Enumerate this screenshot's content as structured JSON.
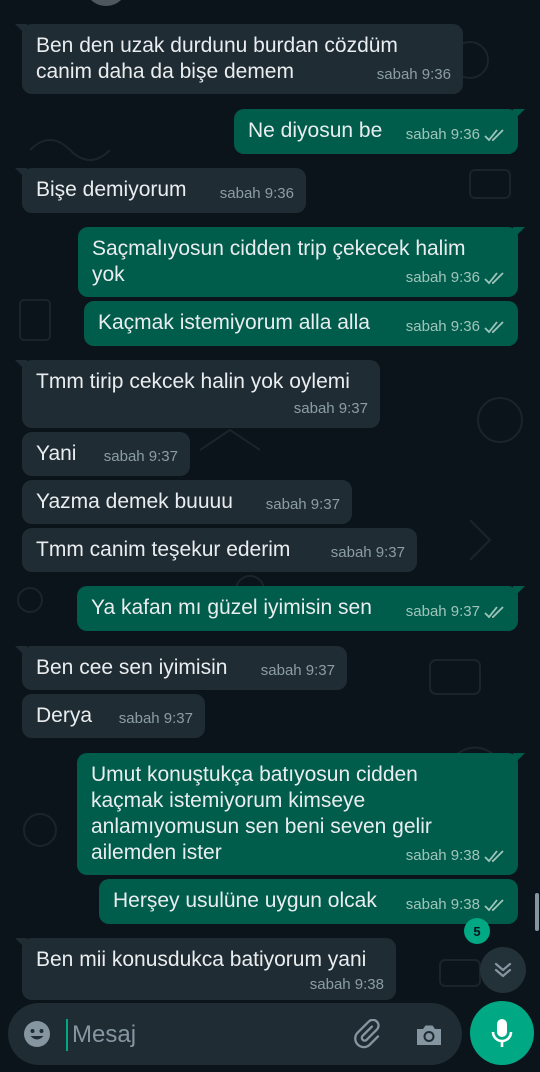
{
  "colors": {
    "background": "#0b141a",
    "incoming_bubble": "#202c33",
    "outgoing_bubble": "#005c4b",
    "accent": "#00a884",
    "read_ticks": "#9fc5bb"
  },
  "messages": [
    {
      "dir": "in",
      "text": "Ben den uzak durdunu burdan cözdüm canim daha da bişe demem",
      "time": "sabah 9:36"
    },
    {
      "dir": "out",
      "text": "Ne diyosun be",
      "time": "sabah 9:36"
    },
    {
      "dir": "in",
      "text": "Bişe demiyorum",
      "time": "sabah 9:36"
    },
    {
      "dir": "out",
      "text": "Saçmalıyosun cidden trip çekecek halim yok",
      "time": "sabah 9:36"
    },
    {
      "dir": "out",
      "text": "Kaçmak istemiyorum alla alla",
      "time": "sabah 9:36"
    },
    {
      "dir": "in",
      "text": "Tmm tirip cekcek halin yok oylemi",
      "time": "sabah 9:37"
    },
    {
      "dir": "in",
      "text": "Yani",
      "time": "sabah 9:37"
    },
    {
      "dir": "in",
      "text": "Yazma demek buuuu",
      "time": "sabah 9:37"
    },
    {
      "dir": "in",
      "text": "Tmm canim teşekur ederim",
      "time": "sabah 9:37"
    },
    {
      "dir": "out",
      "text": "Ya kafan mı güzel iyimisin sen",
      "time": "sabah 9:37"
    },
    {
      "dir": "in",
      "text": "Ben cee sen iyimisin",
      "time": "sabah 9:37"
    },
    {
      "dir": "in",
      "text": "Derya",
      "time": "sabah 9:37"
    },
    {
      "dir": "out",
      "text": "Umut konuştukça batıyosun cidden kaçmak istemiyorum kimseye anlamıyomusun sen beni seven gelir ailemden ister",
      "time": "sabah 9:38"
    },
    {
      "dir": "out",
      "text": "Herşey usulüne uygun olcak",
      "time": "sabah 9:38"
    },
    {
      "dir": "in",
      "text": "Ben mii konusdukca batiyorum yani",
      "time": "sabah 9:38"
    }
  ],
  "unread_count": "5",
  "composer": {
    "placeholder": "Mesaj",
    "icons": [
      "emoji-icon",
      "paperclip-icon",
      "camera-icon",
      "microphone-icon"
    ]
  }
}
